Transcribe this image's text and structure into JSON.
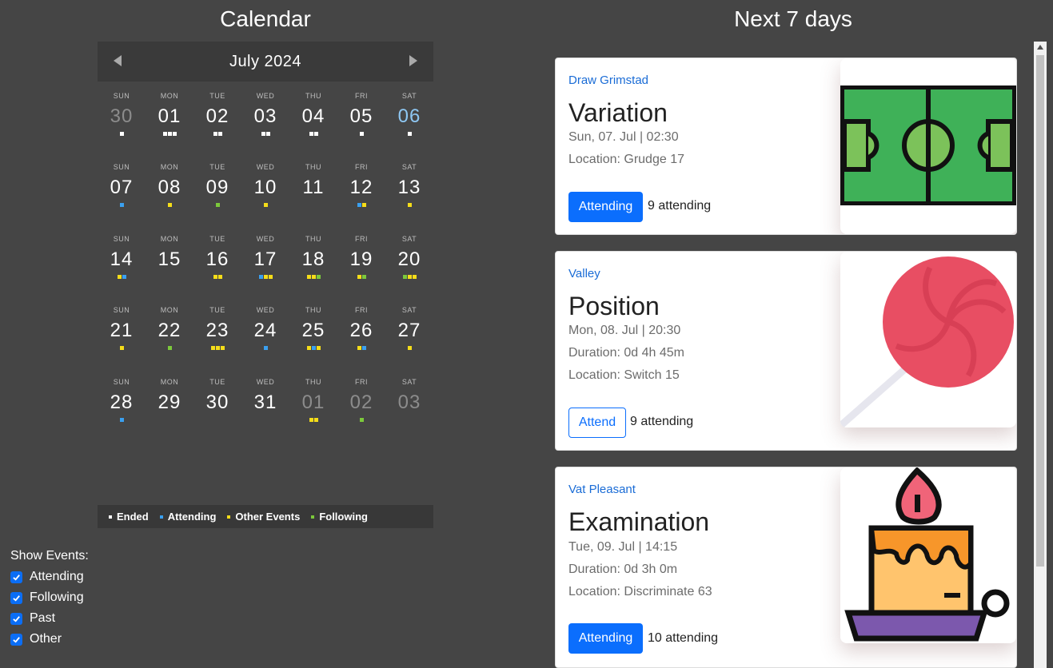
{
  "calendar": {
    "title": "Calendar",
    "month": "July 2024",
    "day_names": [
      "SUN",
      "MON",
      "TUE",
      "WED",
      "THU",
      "FRI",
      "SAT"
    ],
    "weeks": [
      [
        {
          "n": "30",
          "state": "other",
          "dots": [
            "w"
          ]
        },
        {
          "n": "01",
          "dots": [
            "w",
            "w",
            "w"
          ]
        },
        {
          "n": "02",
          "dots": [
            "w",
            "w"
          ]
        },
        {
          "n": "03",
          "dots": [
            "w",
            "w"
          ]
        },
        {
          "n": "04",
          "dots": [
            "w",
            "w"
          ]
        },
        {
          "n": "05",
          "dots": [
            "w"
          ]
        },
        {
          "n": "06",
          "state": "today",
          "dots": [
            "w"
          ]
        }
      ],
      [
        {
          "n": "07",
          "dots": [
            "b"
          ]
        },
        {
          "n": "08",
          "dots": [
            "y"
          ]
        },
        {
          "n": "09",
          "dots": [
            "g"
          ]
        },
        {
          "n": "10",
          "dots": [
            "y"
          ]
        },
        {
          "n": "11",
          "dots": []
        },
        {
          "n": "12",
          "dots": [
            "b",
            "y"
          ]
        },
        {
          "n": "13",
          "dots": [
            "y"
          ]
        }
      ],
      [
        {
          "n": "14",
          "dots": [
            "y",
            "b"
          ]
        },
        {
          "n": "15",
          "dots": []
        },
        {
          "n": "16",
          "dots": [
            "y",
            "y"
          ]
        },
        {
          "n": "17",
          "dots": [
            "b",
            "y",
            "y"
          ]
        },
        {
          "n": "18",
          "dots": [
            "y",
            "y",
            "g"
          ]
        },
        {
          "n": "19",
          "dots": [
            "y",
            "g"
          ]
        },
        {
          "n": "20",
          "dots": [
            "g",
            "y",
            "y"
          ]
        }
      ],
      [
        {
          "n": "21",
          "dots": [
            "y"
          ]
        },
        {
          "n": "22",
          "dots": [
            "g"
          ]
        },
        {
          "n": "23",
          "dots": [
            "y",
            "y",
            "y"
          ]
        },
        {
          "n": "24",
          "dots": [
            "b"
          ]
        },
        {
          "n": "25",
          "dots": [
            "y",
            "b",
            "y"
          ]
        },
        {
          "n": "26",
          "dots": [
            "y",
            "b"
          ]
        },
        {
          "n": "27",
          "dots": [
            "y"
          ]
        }
      ],
      [
        {
          "n": "28",
          "dots": [
            "b"
          ]
        },
        {
          "n": "29",
          "dots": []
        },
        {
          "n": "30",
          "dots": []
        },
        {
          "n": "31",
          "dots": []
        },
        {
          "n": "01",
          "state": "other",
          "dots": [
            "y",
            "y"
          ]
        },
        {
          "n": "02",
          "state": "other",
          "dots": [
            "g"
          ]
        },
        {
          "n": "03",
          "state": "other",
          "dots": []
        }
      ]
    ],
    "dot_colors": {
      "w": "#ffffff",
      "b": "#3aa0f0",
      "y": "#f5dd19",
      "g": "#7cc93b"
    },
    "legend": [
      {
        "label": "Ended",
        "color": "#ffffff"
      },
      {
        "label": "Attending",
        "color": "#3aa0f0"
      },
      {
        "label": "Other Events",
        "color": "#f5dd19"
      },
      {
        "label": "Following",
        "color": "#7cc93b"
      }
    ]
  },
  "filters": {
    "heading": "Show Events:",
    "items": [
      {
        "label": "Attending",
        "checked": true
      },
      {
        "label": "Following",
        "checked": true
      },
      {
        "label": "Past",
        "checked": true
      },
      {
        "label": "Other",
        "checked": true
      }
    ]
  },
  "upcoming": {
    "title": "Next 7 days",
    "events": [
      {
        "org": "Draw Grimstad",
        "name": "Variation",
        "date": "Sun, 07. Jul | 02:30",
        "duration": "",
        "location": "Location: Grudge 17",
        "button": "Attending",
        "button_style": "solid",
        "attending": "9 attending",
        "icon": "football-field-icon"
      },
      {
        "org": "Valley",
        "name": "Position",
        "date": "Mon, 08. Jul | 20:30",
        "duration": "Duration: 0d 4h 45m",
        "location": "Location: Switch 15",
        "button": "Attend",
        "button_style": "outline",
        "attending": "9 attending",
        "icon": "lollipop-icon"
      },
      {
        "org": "Vat Pleasant",
        "name": "Examination",
        "date": "Tue, 09. Jul | 14:15",
        "duration": "Duration: 0d 3h 0m",
        "location": "Location: Discriminate 63",
        "button": "Attending",
        "button_style": "solid",
        "attending": "10 attending",
        "icon": "candle-icon"
      }
    ]
  }
}
